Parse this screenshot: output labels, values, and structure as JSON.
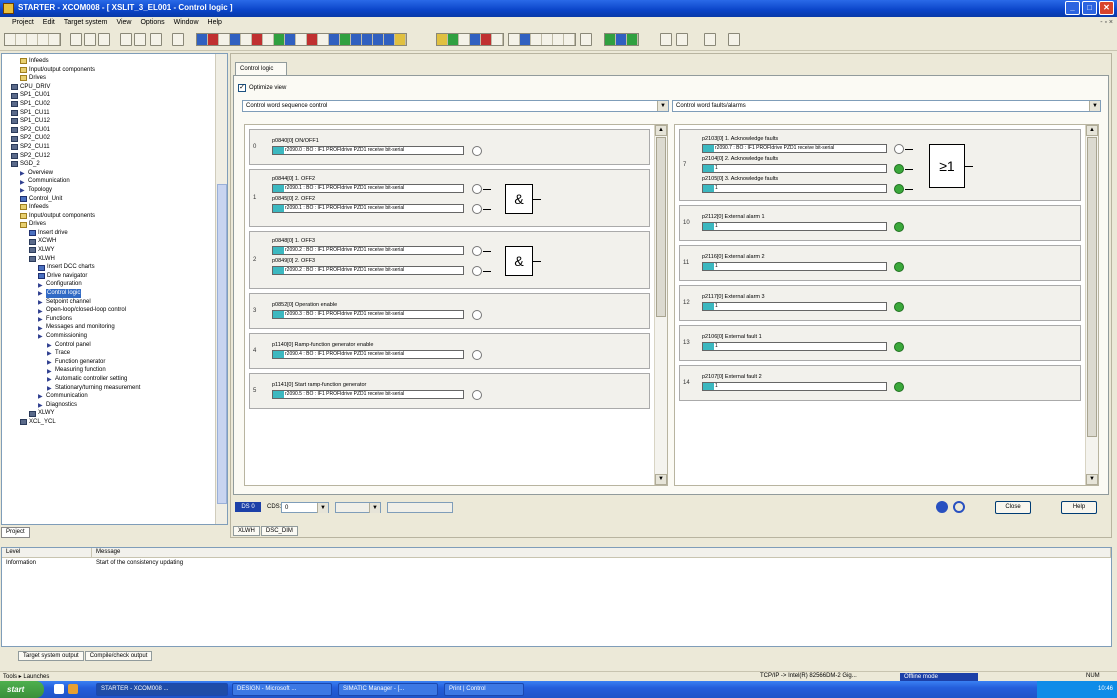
{
  "window": {
    "title": "STARTER - XCOM008 - [ XSLIT_3_EL001 - Control logic ]",
    "btn_min": "_",
    "btn_max": "□",
    "btn_close": "✕"
  },
  "menu": {
    "items": [
      "Project",
      "Edit",
      "Target system",
      "View",
      "Options",
      "Window",
      "Help"
    ],
    "mdi": "- ▫ ×"
  },
  "project_tree": {
    "items": [
      {
        "text": "Infeeds",
        "icon": "folder",
        "indent": 1
      },
      {
        "text": "Input/output components",
        "icon": "folder",
        "indent": 1
      },
      {
        "text": "Drives",
        "icon": "folder",
        "indent": 1
      },
      {
        "text": "CPU_DRIV",
        "icon": "dev",
        "indent": 0
      },
      {
        "text": "SP1_CU01",
        "icon": "dev",
        "indent": 0
      },
      {
        "text": "SP1_CU02",
        "icon": "dev",
        "indent": 0
      },
      {
        "text": "SP1_CU11",
        "icon": "dev",
        "indent": 0
      },
      {
        "text": "SP1_CU12",
        "icon": "dev",
        "indent": 0
      },
      {
        "text": "SP2_CU01",
        "icon": "dev",
        "indent": 0
      },
      {
        "text": "SP2_CU02",
        "icon": "dev",
        "indent": 0
      },
      {
        "text": "SP2_CU11",
        "icon": "dev",
        "indent": 0
      },
      {
        "text": "SP2_CU12",
        "icon": "dev",
        "indent": 0
      },
      {
        "text": "SGD_2",
        "icon": "dev",
        "indent": 0
      },
      {
        "text": "Overview",
        "icon": "arrow",
        "indent": 1
      },
      {
        "text": "Communication",
        "icon": "arrow",
        "indent": 1
      },
      {
        "text": "Topology",
        "icon": "arrow",
        "indent": 1
      },
      {
        "text": "Control_Unit",
        "icon": "blue",
        "indent": 1
      },
      {
        "text": "Infeeds",
        "icon": "folder",
        "indent": 1
      },
      {
        "text": "Input/output components",
        "icon": "folder",
        "indent": 1
      },
      {
        "text": "Drives",
        "icon": "folder",
        "indent": 1
      },
      {
        "text": "Insert drive",
        "icon": "blue",
        "indent": 2
      },
      {
        "text": "XCWH",
        "icon": "dev",
        "indent": 2
      },
      {
        "text": "XLWY",
        "icon": "dev",
        "indent": 2
      },
      {
        "text": "XLWH",
        "icon": "dev",
        "indent": 2
      },
      {
        "text": "Insert DCC charts",
        "icon": "blue",
        "indent": 3
      },
      {
        "text": "Drive navigator",
        "icon": "blue",
        "indent": 3
      },
      {
        "text": "Configuration",
        "icon": "arrow",
        "indent": 3
      },
      {
        "text": "Control logic",
        "icon": "arrow",
        "indent": 3,
        "selected": true
      },
      {
        "text": "Setpoint channel",
        "icon": "arrow",
        "indent": 3
      },
      {
        "text": "Open-loop/closed-loop control",
        "icon": "arrow",
        "indent": 3
      },
      {
        "text": "Functions",
        "icon": "arrow",
        "indent": 3
      },
      {
        "text": "Messages and monitoring",
        "icon": "arrow",
        "indent": 3
      },
      {
        "text": "Commissioning",
        "icon": "arrow",
        "indent": 3
      },
      {
        "text": "Control panel",
        "icon": "arrow",
        "indent": 4
      },
      {
        "text": "Trace",
        "icon": "arrow",
        "indent": 4
      },
      {
        "text": "Function generator",
        "icon": "arrow",
        "indent": 4
      },
      {
        "text": "Measuring function",
        "icon": "arrow",
        "indent": 4
      },
      {
        "text": "Automatic controller setting",
        "icon": "arrow",
        "indent": 4
      },
      {
        "text": "Stationary/turning measurement",
        "icon": "arrow",
        "indent": 4
      },
      {
        "text": "Communication",
        "icon": "arrow",
        "indent": 3
      },
      {
        "text": "Diagnostics",
        "icon": "arrow",
        "indent": 3
      },
      {
        "text": "XLWY",
        "icon": "dev",
        "indent": 2
      },
      {
        "text": "XCL_YCL",
        "icon": "dev",
        "indent": 1
      }
    ]
  },
  "project_tab": "Project",
  "control_logic": {
    "tab": "Control logic",
    "optimize_view_label": "Optimize view",
    "left_combo": "Control word sequence control",
    "right_combo": "Control word faults/alarms",
    "left_blocks": [
      {
        "num": "0",
        "signals": [
          {
            "label": "p0840[0] ON/OFF1",
            "value": "r2090.0 : BO : IF1 PROFIdrive PZD1 receive bit-serial"
          }
        ]
      },
      {
        "num": "1",
        "signals": [
          {
            "label": "p0844[0] 1. OFF2",
            "value": "r2090.1 : BO : IF1 PROFIdrive PZD1 receive bit-serial"
          },
          {
            "label": "p0845[0] 2. OFF2",
            "value": "r2090.1 : BO : IF1 PROFIdrive PZD1 receive bit-serial"
          }
        ],
        "gate": "&"
      },
      {
        "num": "2",
        "signals": [
          {
            "label": "p0848[0] 1. OFF3",
            "value": "r2090.2 : BO : IF1 PROFIdrive PZD1 receive bit-serial"
          },
          {
            "label": "p0849[0] 2. OFF3",
            "value": "r2090.2 : BO : IF1 PROFIdrive PZD1 receive bit-serial"
          }
        ],
        "gate": "&"
      },
      {
        "num": "3",
        "signals": [
          {
            "label": "p0852[0] Operation enable",
            "value": "r2090.3 : BO : IF1 PROFIdrive PZD1 receive bit-serial"
          }
        ]
      },
      {
        "num": "4",
        "signals": [
          {
            "label": "p1140[0] Ramp-function generator enable",
            "value": "r2090.4 : BO : IF1 PROFIdrive PZD1 receive bit-serial"
          }
        ]
      },
      {
        "num": "5",
        "signals": [
          {
            "label": "p1141[0] Start ramp-function generator",
            "value": "r2090.5 : BO : IF1 PROFIdrive PZD1 receive bit-serial"
          }
        ]
      }
    ],
    "right_blocks": [
      {
        "num": "7",
        "signals": [
          {
            "label": "p2103[0] 1. Acknowledge faults",
            "value": "r2090.7 : BO : IF1 PROFIdrive PZD1 receive bit-serial",
            "led": "white"
          },
          {
            "label": "p2104[0] 2. Acknowledge faults",
            "value": "1",
            "led": "green"
          },
          {
            "label": "p2105[0] 3. Acknowledge faults",
            "value": "1",
            "led": "green"
          }
        ],
        "gate": "≥1"
      },
      {
        "num": "10",
        "signals": [
          {
            "label": "p2112[0] External alarm 1",
            "value": "1",
            "led": "green"
          }
        ]
      },
      {
        "num": "11",
        "signals": [
          {
            "label": "p2116[0] External alarm 2",
            "value": "1",
            "led": "green"
          }
        ]
      },
      {
        "num": "12",
        "signals": [
          {
            "label": "p2117[0] External alarm 3",
            "value": "1",
            "led": "green"
          }
        ]
      },
      {
        "num": "13",
        "signals": [
          {
            "label": "p2106[0] External fault 1",
            "value": "1",
            "led": "green"
          }
        ]
      },
      {
        "num": "14",
        "signals": [
          {
            "label": "p2107[0] External fault 2",
            "value": "1",
            "led": "green"
          }
        ]
      }
    ],
    "ds_badge": "DS 0",
    "cds_label": "CDS:",
    "cds_value": "0",
    "close_label": "Close",
    "help_label": "Help"
  },
  "drive_tabs": [
    "XLWH",
    "DSC_DIM"
  ],
  "detail": {
    "columns": [
      "Level",
      "Message"
    ],
    "rows": [
      {
        "level": "Information",
        "message": "Start of the consistency updating"
      }
    ]
  },
  "output_tabs": [
    "Target system output",
    "Compile/check output"
  ],
  "status": {
    "left": "Tools ▸ Launches",
    "mid": "TCP/IP -> Intel(R) 82566DM-2 Gig...",
    "mode": "Offline mode",
    "right": "NUM"
  },
  "taskbar": {
    "start": "start",
    "tasks": [
      "STARTER - XCOM008 ...",
      "DESIGN - Microsoft ...",
      "SIMATIC Manager - [...",
      "Print | Control"
    ],
    "clock": "10:46"
  }
}
